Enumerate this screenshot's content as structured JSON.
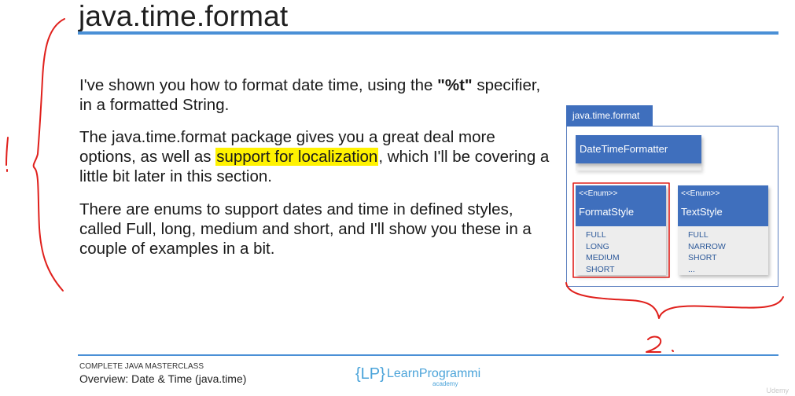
{
  "slide": {
    "title": "java.time.format",
    "paragraphs": {
      "p1_pre": "I've shown you how to format date time, using the ",
      "p1_bold": "\"%t\"",
      "p1_post": " specifier, in a formatted String.",
      "p2_pre": "The java.time.format package gives you a great deal more options, as well as ",
      "p2_highlight": "support for localization",
      "p2_post": ", which I'll be covering a little bit later in this section.",
      "p3": "There are enums to support dates and time in defined styles, called Full, long, medium and short, and I'll show you these in a couple of examples in a bit."
    }
  },
  "diagram": {
    "package_label": "java.time.format",
    "class_name": "DateTimeFormatter",
    "enums": [
      {
        "stereotype": "<<Enum>>",
        "name": "FormatStyle",
        "values": [
          "FULL",
          "LONG",
          "MEDIUM",
          "SHORT"
        ]
      },
      {
        "stereotype": "<<Enum>>",
        "name": "TextStyle",
        "values": [
          "FULL",
          "NARROW",
          "SHORT",
          "..."
        ]
      }
    ],
    "accent_color": "#3f6fbd"
  },
  "annotations": {
    "left_mark": "1.",
    "bottom_mark": "2.",
    "ink_color": "#e0201c"
  },
  "footer": {
    "course": "COMPLETE JAVA MASTERCLASS",
    "subtitle": "Overview: Date & Time (java.time)",
    "logo_main": "LearnProgramming",
    "logo_sub": "academy",
    "logo_bracket": "{LP}"
  },
  "watermark": "Udemy"
}
